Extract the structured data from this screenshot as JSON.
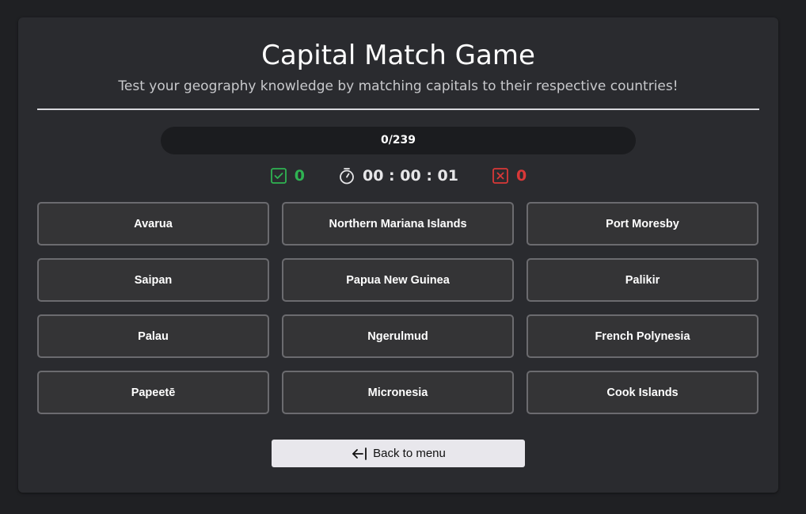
{
  "header": {
    "title": "Capital Match Game",
    "subtitle": "Test your geography knowledge by matching capitals to their respective countries!"
  },
  "progress": {
    "label": "0/239",
    "fraction": 0
  },
  "stats": {
    "correct": "0",
    "timer": "00 : 00 : 01",
    "wrong": "0"
  },
  "tiles": [
    "Avarua",
    "Northern Mariana Islands",
    "Port Moresby",
    "Saipan",
    "Papua New Guinea",
    "Palikir",
    "Palau",
    "Ngerulmud",
    "French Polynesia",
    "Papeetē",
    "Micronesia",
    "Cook Islands"
  ],
  "back_button": {
    "label": "Back to menu"
  },
  "colors": {
    "background": "#1f2023",
    "card": "#2a2b2f",
    "correct": "#2fb352",
    "wrong": "#d93838",
    "tile_bg": "#343436",
    "tile_border": "#6b6b6f",
    "button_bg": "#e8e7ec"
  },
  "icons": {
    "correct": "check-square-icon",
    "timer": "stopwatch-icon",
    "wrong": "x-square-icon",
    "back": "arrow-left-bar-icon"
  }
}
